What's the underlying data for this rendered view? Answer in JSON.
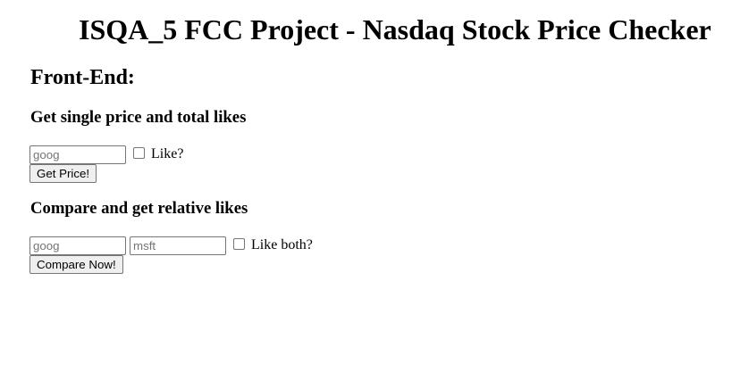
{
  "header": {
    "title": "ISQA_5 FCC Project - Nasdaq Stock Price Checker"
  },
  "front_end": {
    "heading": "Front-End:",
    "single_form": {
      "heading": "Get single price and total likes",
      "stock_placeholder": "goog",
      "stock_value": "",
      "like_label": "Like?",
      "like_checked": false,
      "submit_label": "Get Price!"
    },
    "compare_form": {
      "heading": "Compare and get relative likes",
      "stock1_placeholder": "goog",
      "stock1_value": "",
      "stock2_placeholder": "msft",
      "stock2_value": "",
      "like_label": "Like both?",
      "like_checked": false,
      "submit_label": "Compare Now!"
    }
  }
}
